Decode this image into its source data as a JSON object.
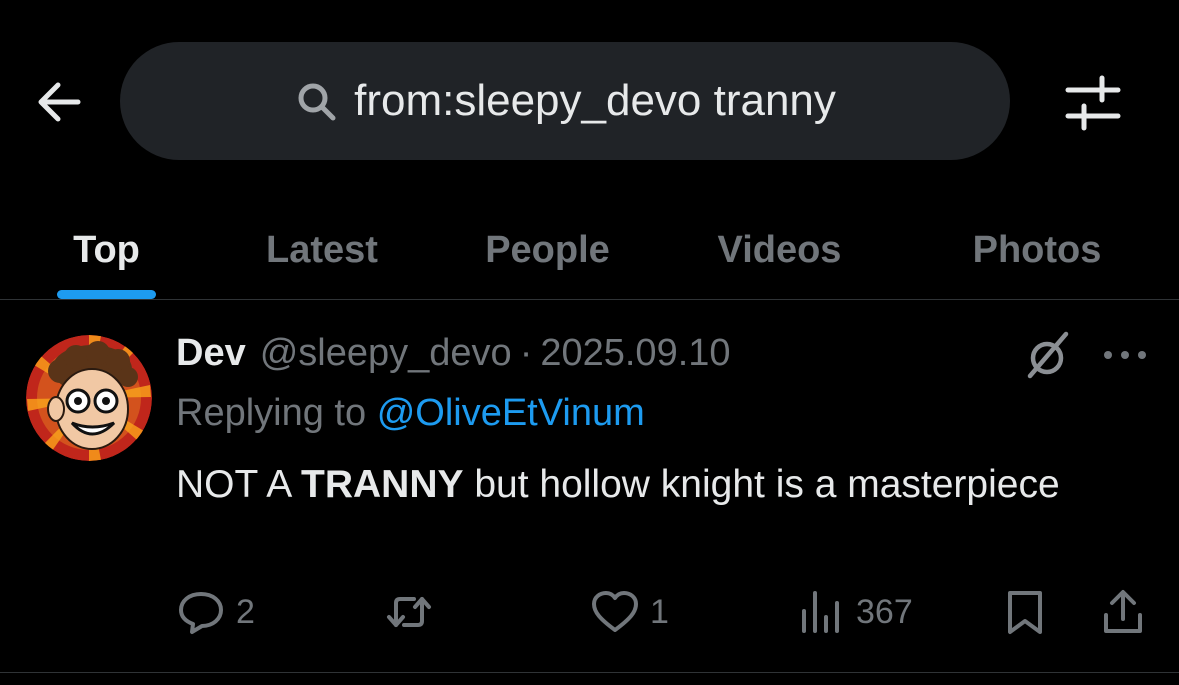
{
  "search": {
    "query": "from:sleepy_devo tranny"
  },
  "tabs": [
    {
      "label": "Top",
      "active": true
    },
    {
      "label": "Latest",
      "active": false
    },
    {
      "label": "People",
      "active": false
    },
    {
      "label": "Videos",
      "active": false
    },
    {
      "label": "Photos",
      "active": false
    }
  ],
  "tweet": {
    "name": "Dev",
    "handle": "@sleepy_devo",
    "separator": "·",
    "date": "2025.09.10",
    "replying_prefix": "Replying to",
    "replying_to": "@OliveEtVinum",
    "text_part1": "NOT A ",
    "text_bold": "TRANNY",
    "text_part2": " but hollow knight is a masterpiece",
    "replies": "2",
    "reposts": "",
    "likes": "1",
    "views": "367"
  },
  "icons": {
    "back": "back-arrow-icon",
    "search": "search-icon",
    "filter": "filter-sliders-icon",
    "grok": "grok-icon",
    "more": "more-dots-icon",
    "reply": "reply-icon",
    "repost": "repost-icon",
    "like": "heart-icon",
    "views": "views-chart-icon",
    "bookmark": "bookmark-icon",
    "share": "share-icon"
  },
  "colors": {
    "background": "#000000",
    "accent": "#1d9bf0",
    "text_primary": "#e7e9ea",
    "text_secondary": "#71767b",
    "search_bg": "#202327"
  }
}
